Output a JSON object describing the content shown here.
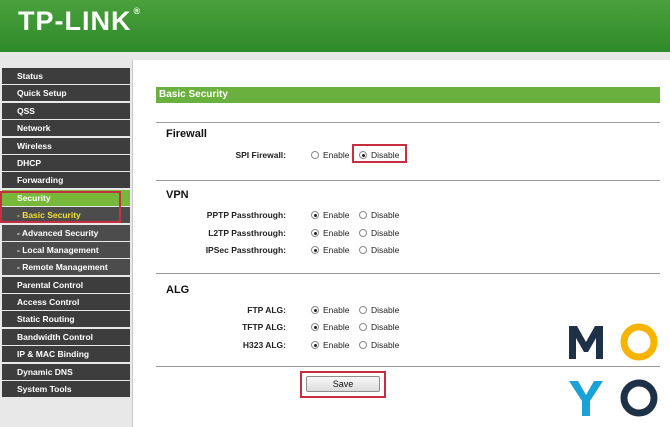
{
  "header": {
    "logo": "TP-LINK",
    "trademark": "®"
  },
  "sidebar": {
    "items": [
      {
        "label": "Status"
      },
      {
        "label": "Quick Setup"
      },
      {
        "label": "QSS"
      },
      {
        "label": "Network"
      },
      {
        "label": "Wireless"
      },
      {
        "label": "DHCP"
      },
      {
        "label": "Forwarding"
      },
      {
        "label": "Security"
      },
      {
        "label": "- Basic Security"
      },
      {
        "label": "- Advanced Security"
      },
      {
        "label": "- Local Management"
      },
      {
        "label": "- Remote Management"
      },
      {
        "label": "Parental Control"
      },
      {
        "label": "Access Control"
      },
      {
        "label": "Static Routing"
      },
      {
        "label": "Bandwidth Control"
      },
      {
        "label": "IP & MAC Binding"
      },
      {
        "label": "Dynamic DNS"
      },
      {
        "label": "System Tools"
      }
    ]
  },
  "main": {
    "title": "Basic Security",
    "firewall": {
      "heading": "Firewall",
      "rows": [
        {
          "label": "SPI Firewall:",
          "selected": "Disable"
        }
      ]
    },
    "vpn": {
      "heading": "VPN",
      "rows": [
        {
          "label": "PPTP Passthrough:",
          "selected": "Enable"
        },
        {
          "label": "L2TP Passthrough:",
          "selected": "Enable"
        },
        {
          "label": "IPSec Passthrough:",
          "selected": "Enable"
        }
      ]
    },
    "alg": {
      "heading": "ALG",
      "rows": [
        {
          "label": "FTP ALG:",
          "selected": "Enable"
        },
        {
          "label": "TFTP ALG:",
          "selected": "Enable"
        },
        {
          "label": "H323 ALG:",
          "selected": "Enable"
        }
      ]
    },
    "options": {
      "enable": "Enable",
      "disable": "Disable"
    },
    "save_label": "Save"
  },
  "watermark": {
    "letters": [
      "M",
      "Y"
    ],
    "colors": {
      "dark": "#1f3147",
      "yellow": "#f6b400",
      "blue": "#1aa2d8"
    }
  },
  "colors": {
    "header_green": "#3c9634",
    "title_green": "#6ab03e",
    "highlight_red": "#c62f3f",
    "menu_dark": "#3d3d3d"
  }
}
